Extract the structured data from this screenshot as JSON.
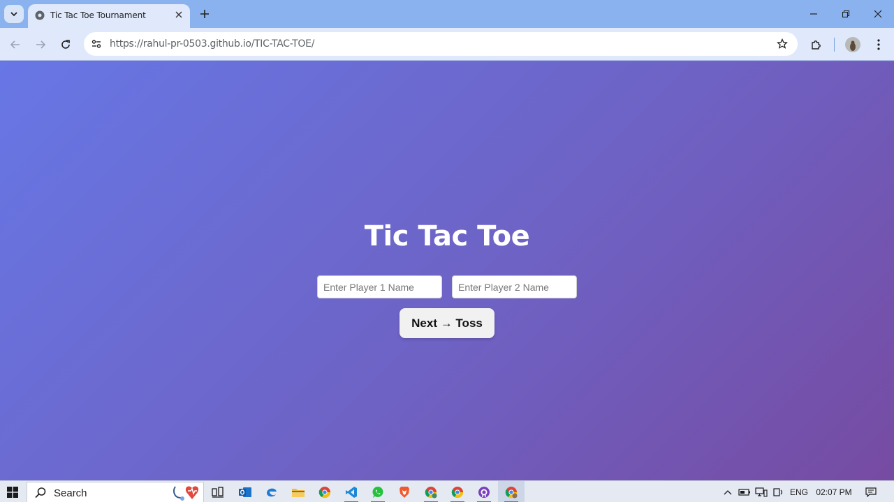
{
  "browser": {
    "tab_title": "Tic Tac Toe Tournament",
    "url_host": "https://rahul-pr-0503.github.io",
    "url_path": "/TIC-TAC-TOE/"
  },
  "page": {
    "title": "Tic Tac Toe",
    "player1_placeholder": "Enter Player 1 Name",
    "player2_placeholder": "Enter Player 2 Name",
    "player1_value": "",
    "player2_value": "",
    "next_button_label": "Next → Toss"
  },
  "taskbar": {
    "search_label": "Search",
    "pinned_apps": [
      "task-view",
      "outlook",
      "edge",
      "file-explorer",
      "chrome",
      "vscode",
      "whatsapp",
      "brave",
      "chrome-profile-2",
      "chrome-profile-3",
      "github-desktop",
      "chrome-active"
    ],
    "language": "ENG",
    "clock": "02:07 PM"
  },
  "colors": {
    "gradient_start": "#6777e5",
    "gradient_end": "#764ba2",
    "tabbar": "#8ab2ee",
    "toolbar": "#dfe9fb"
  }
}
